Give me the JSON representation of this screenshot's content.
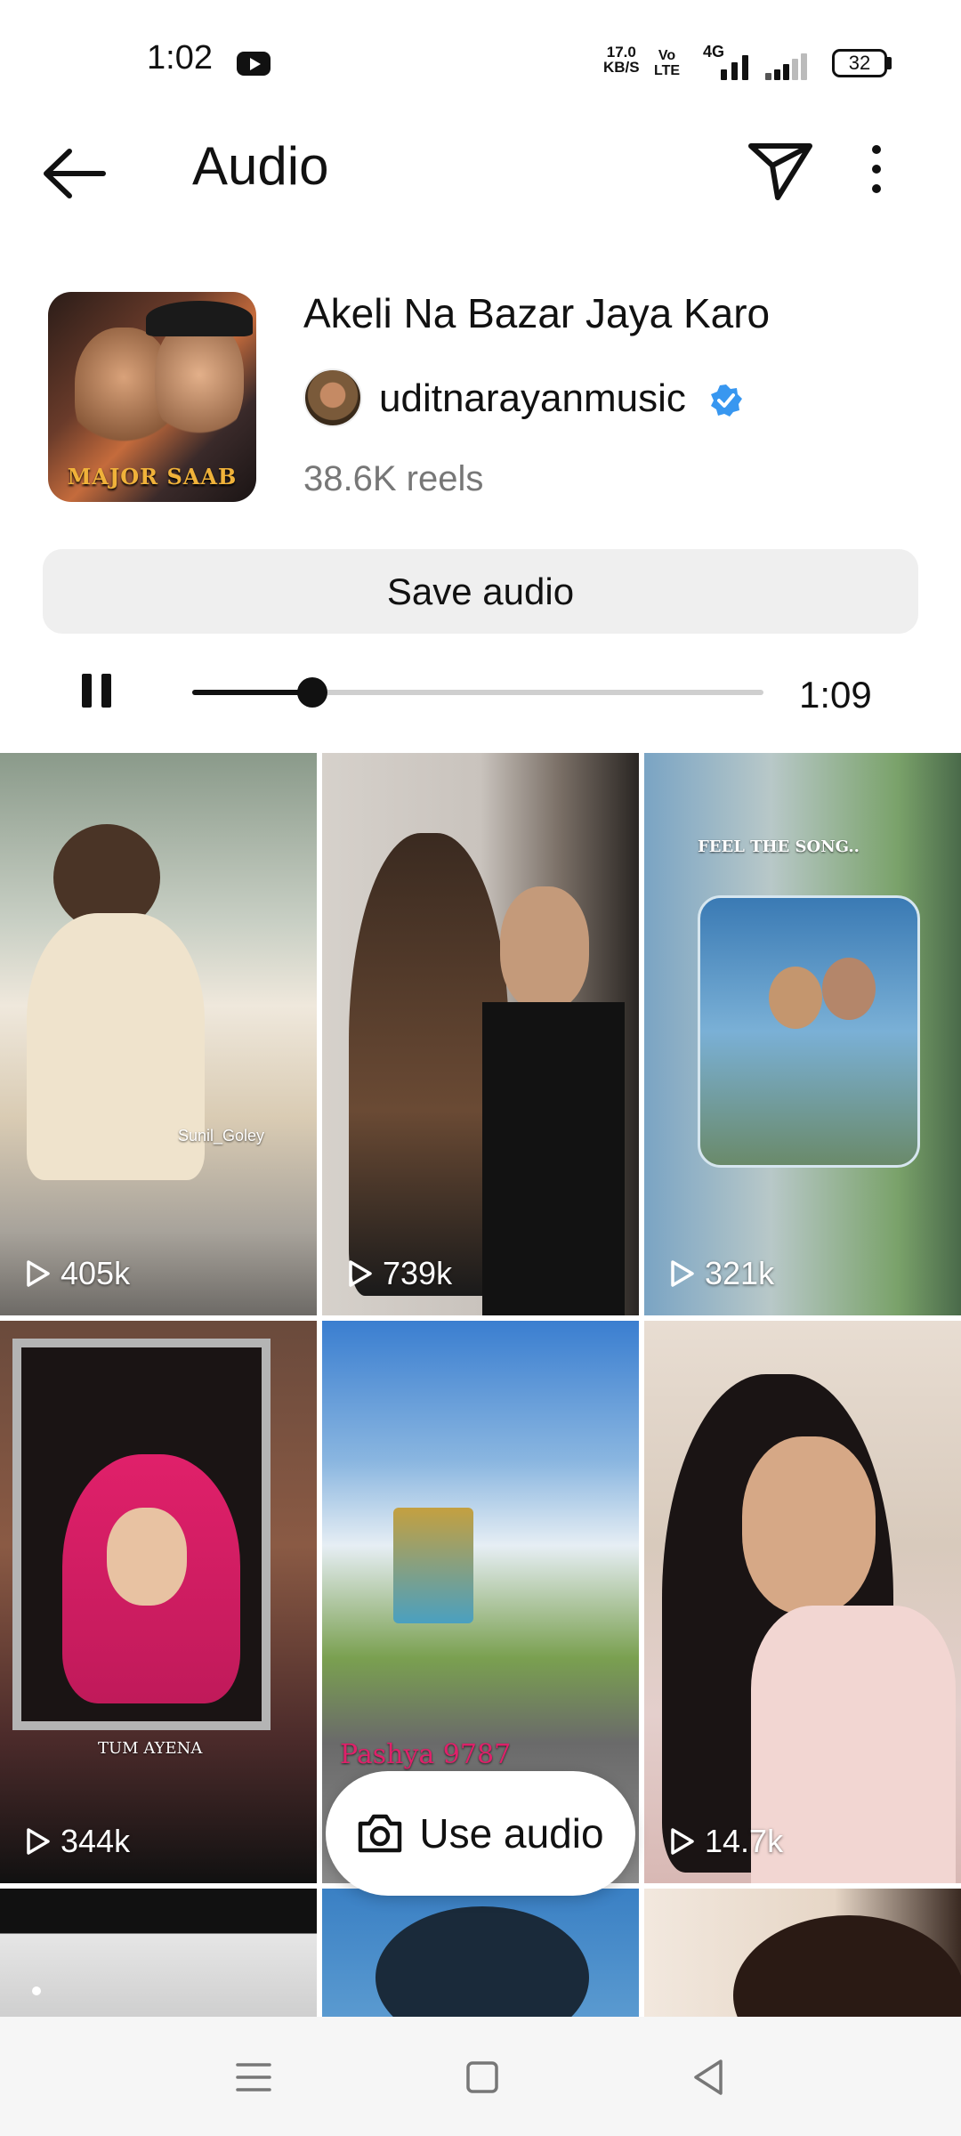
{
  "status_bar": {
    "time": "1:02",
    "net_speed_value": "17.0",
    "net_speed_unit": "KB/S",
    "volte_top": "Vo",
    "volte_bottom": "LTE",
    "network": "4G",
    "battery": "32"
  },
  "header": {
    "title": "Audio",
    "back_icon": "arrow-left-icon",
    "share_icon": "paper-plane-icon",
    "more_icon": "more-vertical-icon"
  },
  "audio": {
    "cover_text": "MAJOR SAAB",
    "title": "Akeli Na Bazar Jaya Karo",
    "artist": "uditnarayanmusic",
    "verified": true,
    "reels_count": "38.6K reels",
    "save_label": "Save audio"
  },
  "player": {
    "state": "playing",
    "progress": 0.21,
    "duration": "1:09"
  },
  "reels": [
    {
      "views": "405k",
      "overlay": "Sunil_Goley"
    },
    {
      "views": "739k",
      "overlay": ""
    },
    {
      "views": "321k",
      "overlay": "FEEL THE SONG.."
    },
    {
      "views": "344k",
      "overlay": "TUM AYENA"
    },
    {
      "views": "",
      "overlay": "Pashya 9787"
    },
    {
      "views": "14.7k",
      "overlay": ""
    },
    {
      "views": "",
      "overlay": ""
    },
    {
      "views": "",
      "overlay": ""
    },
    {
      "views": "",
      "overlay": ""
    }
  ],
  "use_audio": {
    "label": "Use audio",
    "icon": "camera-icon"
  },
  "nav": {
    "menu_icon": "menu-icon",
    "home_icon": "square-home-icon",
    "back_icon": "triangle-back-icon"
  },
  "colors": {
    "verified": "#3897f0",
    "save_bg": "#efefef",
    "progress": "#111111"
  }
}
